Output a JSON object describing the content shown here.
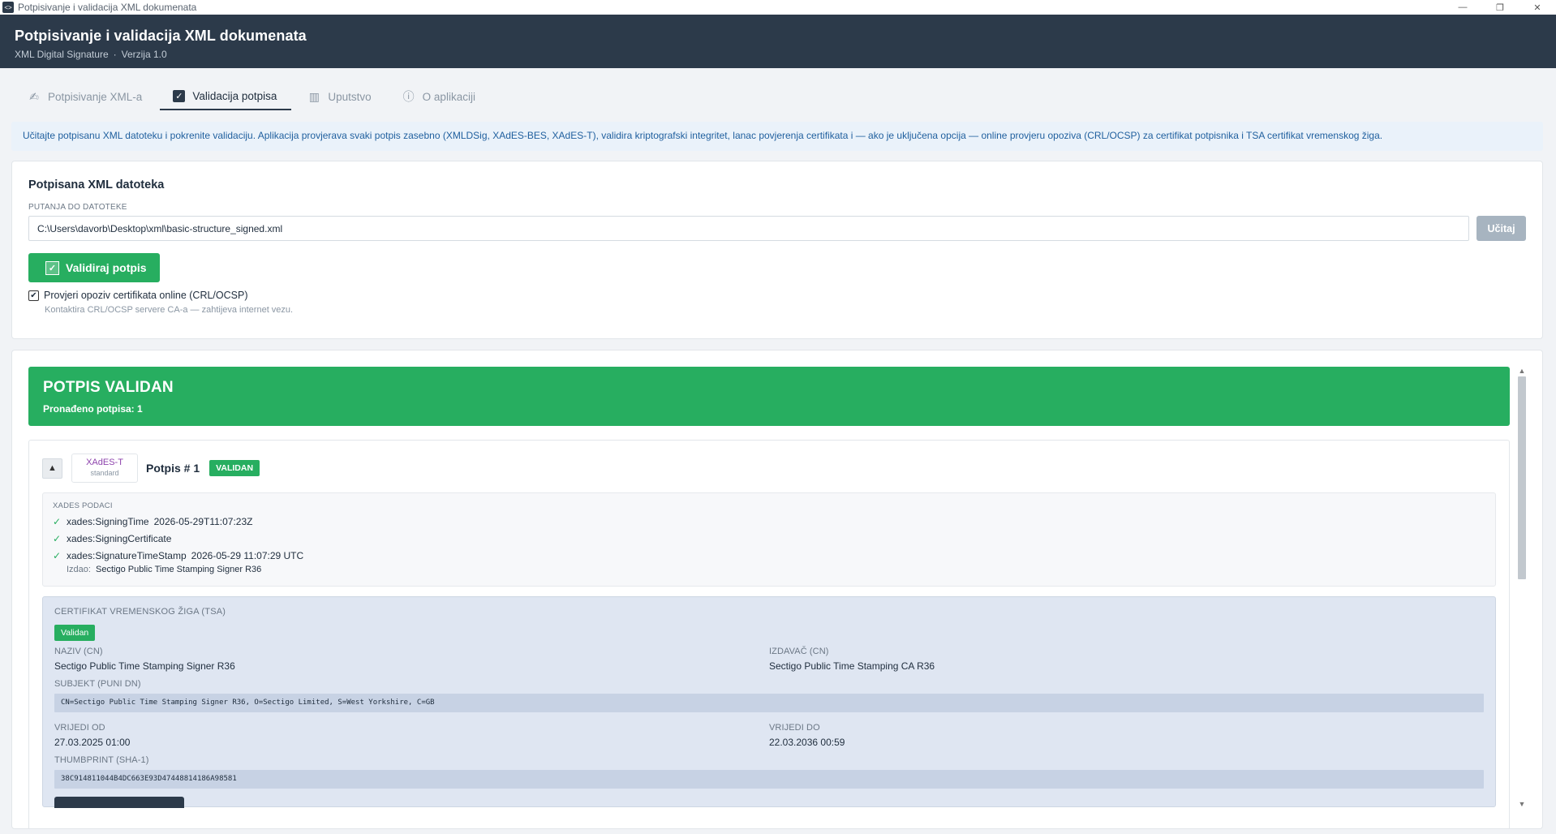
{
  "window": {
    "title": "Potpisivanje i validacija XML dokumenata",
    "controls": {
      "minimize": "—",
      "restore": "❐",
      "close": "✕"
    }
  },
  "header": {
    "title": "Potpisivanje i validacija XML dokumenata",
    "subtitle": "XML Digital Signature",
    "separator": "·",
    "version": "Verzija 1.0"
  },
  "tabs": [
    {
      "label": "Potpisivanje XML-a",
      "icon": "sign-icon",
      "active": false
    },
    {
      "label": "Validacija potpisa",
      "icon": "checkbox-icon",
      "active": true
    },
    {
      "label": "Uputstvo",
      "icon": "book-icon",
      "active": false
    },
    {
      "label": "O aplikaciji",
      "icon": "info-icon",
      "active": false
    }
  ],
  "info_text": "Učitajte potpisanu XML datoteku i pokrenite validaciju. Aplikacija provjerava svaki potpis zasebno (XMLDSig, XAdES-BES, XAdES-T), validira kriptografski integritet, lanac povjerenja certifikata i — ako je uključena opcija — online provjeru opoziva (CRL/OCSP) za certifikat potpisnika i TSA certifikat vremenskog žiga.",
  "file_card": {
    "title": "Potpisana XML datoteka",
    "path_label": "PUTANJA DO DATOTEKE",
    "path_value": "C:\\Users\\davorb\\Desktop\\xml\\basic-structure_signed.xml",
    "load_button": "Učitaj",
    "validate_button": "Validiraj potpis",
    "revocation_checkbox": {
      "label": "Provjeri opoziv certifikata online (CRL/OCSP)",
      "checked": true
    },
    "revocation_hint": "Kontaktira CRL/OCSP servere CA-a — zahtijeva internet vezu."
  },
  "result": {
    "title": "POTPIS VALIDAN",
    "count_label": "Pronađeno potpisa:",
    "count": "1",
    "color": "#27ae60"
  },
  "signature": {
    "collapse_glyph": "▲",
    "standard": "XAdES-T",
    "standard_sub": "standard",
    "title": "Potpis # 1",
    "status": "VALIDAN",
    "xades": {
      "label": "XAdES PODACI",
      "items": [
        {
          "name": "xades:SigningTime",
          "value": "2026-05-29T11:07:23Z"
        },
        {
          "name": "xades:SigningCertificate",
          "value": ""
        },
        {
          "name": "xades:SignatureTimeStamp",
          "value": "2026-05-29 11:07:29 UTC"
        }
      ],
      "issuer_label": "Izdao:",
      "issuer_value": "Sectigo Public Time Stamping Signer R36"
    },
    "tsa": {
      "label": "CERTIFIKAT VREMENSKOG ŽIGA (TSA)",
      "status": "Validan",
      "name_label": "NAZIV (CN)",
      "name_value": "Sectigo Public Time Stamping Signer R36",
      "issuer_label": "IZDAVAČ (CN)",
      "issuer_value": "Sectigo Public Time Stamping CA R36",
      "subject_label": "SUBJEKT (puni DN)",
      "subject_value": "CN=Sectigo Public Time Stamping Signer R36, O=Sectigo Limited, S=West Yorkshire, C=GB",
      "valid_from_label": "VRIJEDI OD",
      "valid_from_value": "27.03.2025 01:00",
      "valid_to_label": "VRIJEDI DO",
      "valid_to_value": "22.03.2036 00:59",
      "thumb_label": "THUMBPRINT (SHA-1)",
      "thumb_value": "38C914811044B4DC663E93D47448814186A98581"
    }
  }
}
